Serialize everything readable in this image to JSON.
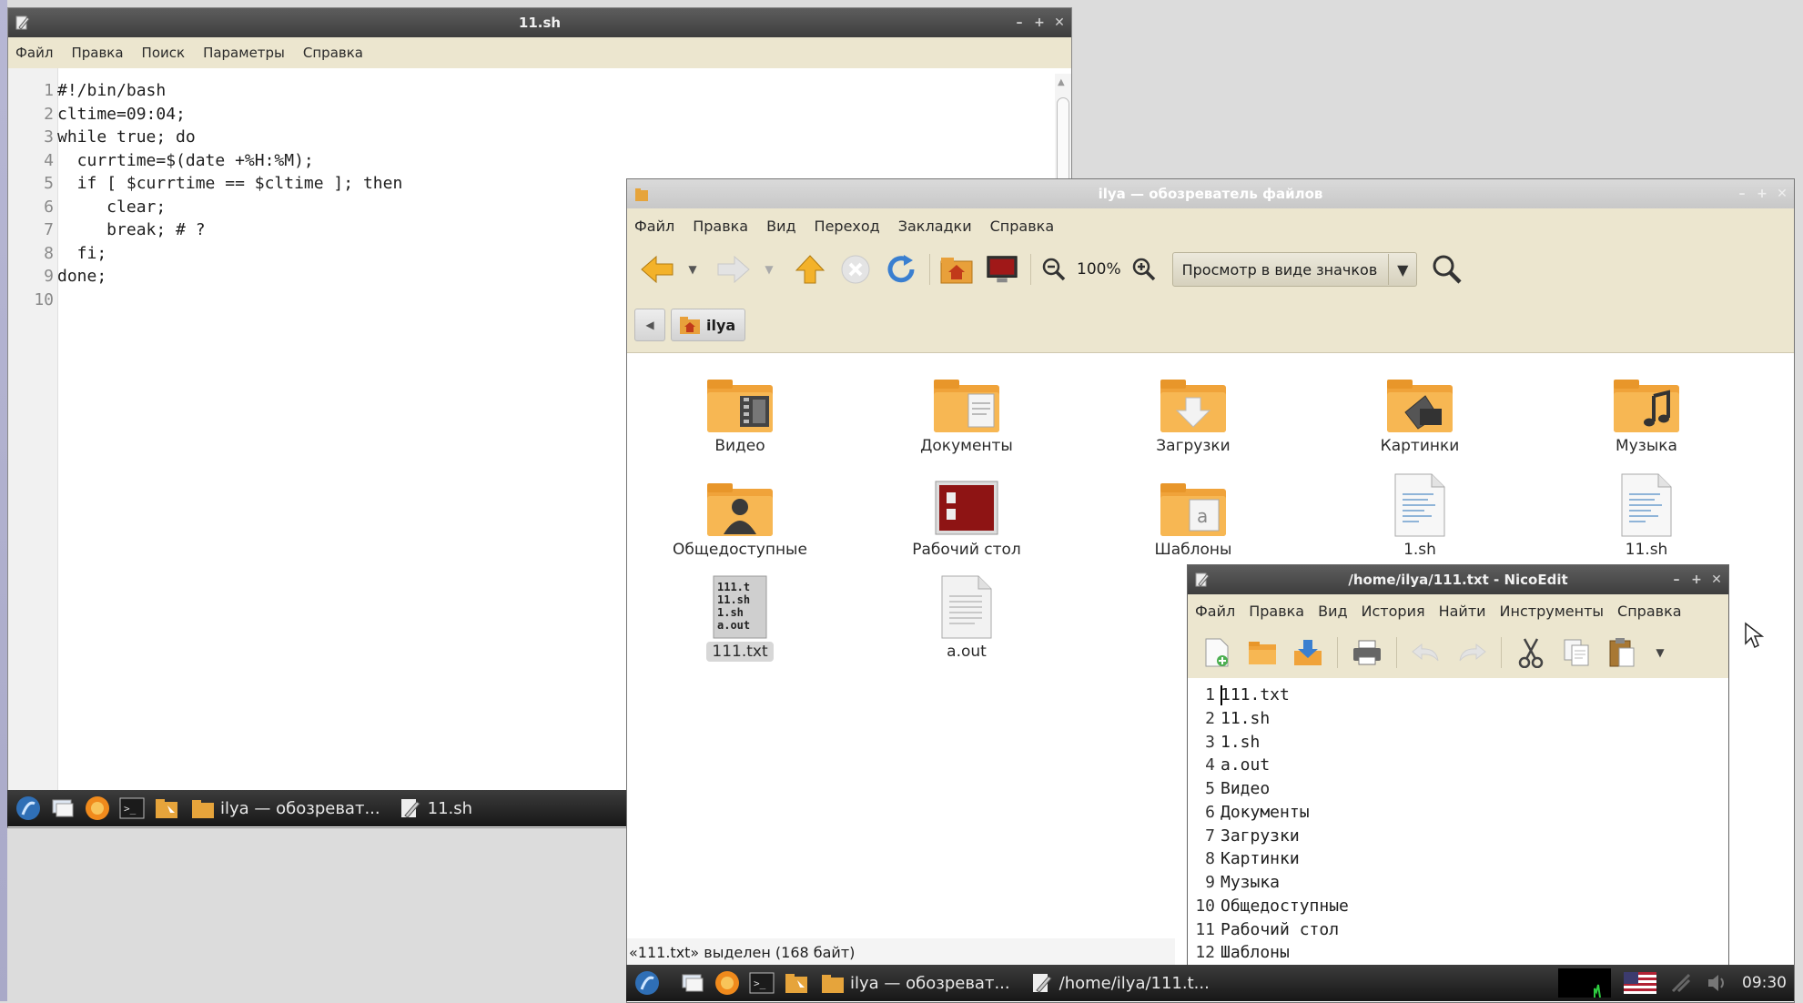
{
  "editor": {
    "title": "11.sh",
    "menu": [
      "Файл",
      "Правка",
      "Поиск",
      "Параметры",
      "Справка"
    ],
    "lines": [
      {
        "n": "1",
        "text": "#!/bin/bash"
      },
      {
        "n": "2",
        "text": "cltime=09:04;"
      },
      {
        "n": "3",
        "text": "while true; do"
      },
      {
        "n": "4",
        "text": "  currtime=$(date +%H:%M);"
      },
      {
        "n": "5",
        "text": "  if [ $currtime == $cltime ]; then"
      },
      {
        "n": "6",
        "text": "     clear;"
      },
      {
        "n": "7",
        "text": "     break; # ?"
      },
      {
        "n": "8",
        "text": "  fi;"
      },
      {
        "n": "9",
        "text": "done;"
      },
      {
        "n": "10",
        "text": ""
      }
    ]
  },
  "taskbar_left": {
    "tasks": [
      {
        "label": "ilya — обозреват..."
      },
      {
        "label": "11.sh"
      }
    ]
  },
  "filemanager": {
    "title": "ilya — обозреватель файлов",
    "menu": [
      "Файл",
      "Правка",
      "Вид",
      "Переход",
      "Закладки",
      "Справка"
    ],
    "zoom": "100%",
    "view_mode": "Просмотр в виде значков",
    "location": "ilya",
    "items": [
      {
        "label": "Видео",
        "icon": "video-folder-icon"
      },
      {
        "label": "Документы",
        "icon": "documents-folder-icon"
      },
      {
        "label": "Загрузки",
        "icon": "downloads-folder-icon"
      },
      {
        "label": "Картинки",
        "icon": "pictures-folder-icon"
      },
      {
        "label": "Музыка",
        "icon": "music-folder-icon"
      },
      {
        "label": "Общедоступные",
        "icon": "public-folder-icon"
      },
      {
        "label": "Рабочий стол",
        "icon": "desktop-folder-icon"
      },
      {
        "label": "Шаблоны",
        "icon": "templates-folder-icon"
      },
      {
        "label": "1.sh",
        "icon": "script-file-icon"
      },
      {
        "label": "11.sh",
        "icon": "script-file-icon"
      },
      {
        "label": "111.txt",
        "icon": "text-file-icon",
        "selected": true
      },
      {
        "label": "a.out",
        "icon": "binary-file-icon"
      }
    ],
    "status": "«111.txt» выделен (168 байт)"
  },
  "nicoedit": {
    "title": "/home/ilya/111.txt - NicoEdit",
    "menu": [
      "Файл",
      "Правка",
      "Вид",
      "История",
      "Найти",
      "Инструменты",
      "Справка"
    ],
    "lines": [
      {
        "n": "1",
        "text": "111.txt"
      },
      {
        "n": "2",
        "text": "11.sh"
      },
      {
        "n": "3",
        "text": "1.sh"
      },
      {
        "n": "4",
        "text": "a.out"
      },
      {
        "n": "5",
        "text": "Видео"
      },
      {
        "n": "6",
        "text": "Документы"
      },
      {
        "n": "7",
        "text": "Загрузки"
      },
      {
        "n": "8",
        "text": "Картинки"
      },
      {
        "n": "9",
        "text": "Музыка"
      },
      {
        "n": "10",
        "text": "Общедоступные"
      },
      {
        "n": "11",
        "text": "Рабочий стол"
      },
      {
        "n": "12",
        "text": "Шаблоны"
      }
    ]
  },
  "taskbar_right": {
    "tasks": [
      {
        "label": "ilya — обозреват..."
      },
      {
        "label": "/home/ilya/111.t..."
      }
    ],
    "clock": "09:30"
  },
  "colors": {
    "menubar_bg": "#ece6cf",
    "titlebar_active": "#4a4a4a",
    "taskbar_bg": "#202020",
    "folder_orange": "#f5a623"
  }
}
